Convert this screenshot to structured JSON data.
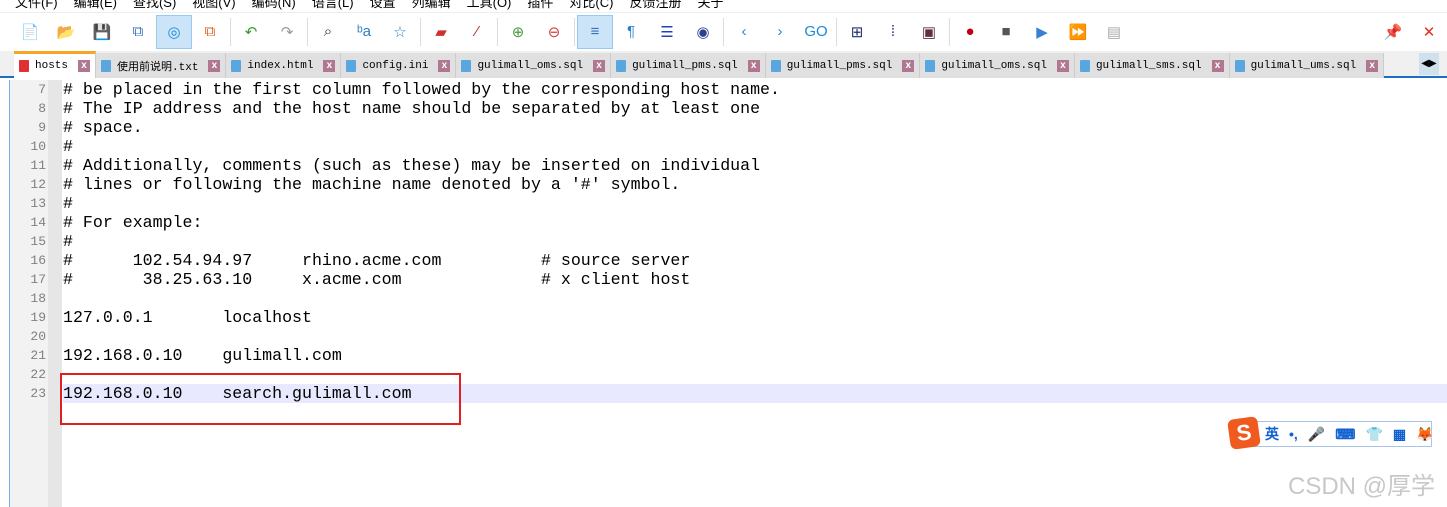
{
  "menu": [
    "文件(F)",
    "编辑(E)",
    "查找(S)",
    "视图(V)",
    "编码(N)",
    "语言(L)",
    "设置",
    "列编辑",
    "工具(O)",
    "插件",
    "对比(C)",
    "反馈注册",
    "关于"
  ],
  "toolbar_icons": [
    "new-file",
    "open-file",
    "save",
    "save-all",
    "auto-save",
    "close-all",
    "undo",
    "redo",
    "find",
    "replace",
    "bookmark",
    "mark",
    "clear-mark",
    "zoom-in",
    "zoom-out",
    "word-wrap",
    "show-all-chars",
    "indent-guide",
    "doc-map",
    "prev",
    "next",
    "go-to",
    "sync-v",
    "sync-h",
    "monitor",
    "record-macro",
    "stop-record",
    "play-macro",
    "run-macro-multiple",
    "save-macro",
    "pin",
    "close"
  ],
  "tabs": [
    {
      "label": "hosts",
      "active": true
    },
    {
      "label": "使用前说明.txt"
    },
    {
      "label": "index.html"
    },
    {
      "label": "config.ini"
    },
    {
      "label": "gulimall_oms.sql"
    },
    {
      "label": "gulimall_pms.sql"
    },
    {
      "label": "gulimall_pms.sql"
    },
    {
      "label": "gulimall_oms.sql"
    },
    {
      "label": "gulimall_sms.sql"
    },
    {
      "label": "gulimall_ums.sql"
    }
  ],
  "editor": {
    "current_line": 23,
    "lines": [
      {
        "n": "7",
        "t": "# be placed in the first column followed by the corresponding host name."
      },
      {
        "n": "8",
        "t": "# The IP address and the host name should be separated by at least one"
      },
      {
        "n": "9",
        "t": "# space."
      },
      {
        "n": "10",
        "t": "#"
      },
      {
        "n": "11",
        "t": "# Additionally, comments (such as these) may be inserted on individual"
      },
      {
        "n": "12",
        "t": "# lines or following the machine name denoted by a '#' symbol."
      },
      {
        "n": "13",
        "t": "#"
      },
      {
        "n": "14",
        "t": "# For example:"
      },
      {
        "n": "15",
        "t": "#"
      },
      {
        "n": "16",
        "t": "#      102.54.94.97     rhino.acme.com          # source server"
      },
      {
        "n": "17",
        "t": "#       38.25.63.10     x.acme.com              # x client host"
      },
      {
        "n": "18",
        "t": ""
      },
      {
        "n": "19",
        "t": "127.0.0.1       localhost"
      },
      {
        "n": "20",
        "t": ""
      },
      {
        "n": "21",
        "t": "192.168.0.10    gulimall.com"
      },
      {
        "n": "22",
        "t": ""
      },
      {
        "n": "23",
        "t": "192.168.0.10    search.gulimall.com"
      }
    ]
  },
  "ime": {
    "logo": "S",
    "lang": "英",
    "punct": "•,",
    "mic": "🎤",
    "keyboard": "⌨",
    "skin": "👕",
    "apps": "▦",
    "mascot": "🦊"
  },
  "watermark": "CSDN @厚学",
  "colors": {
    "highlight": "#e8e8ff",
    "annotation_box": "#e02020",
    "active_tab_accent": "#f6a623"
  }
}
